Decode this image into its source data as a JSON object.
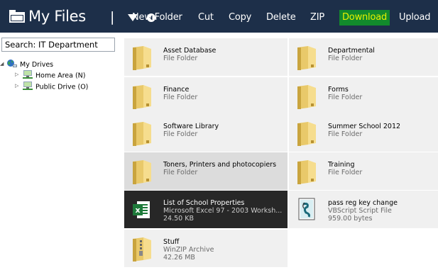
{
  "header": {
    "title": "My Files",
    "separator": "|",
    "toolbar": [
      {
        "id": "new-folder",
        "label": "New Folder"
      },
      {
        "id": "cut",
        "label": "Cut"
      },
      {
        "id": "copy",
        "label": "Copy"
      },
      {
        "id": "delete",
        "label": "Delete"
      },
      {
        "id": "zip",
        "label": "ZIP"
      },
      {
        "id": "download",
        "label": "Download",
        "active": true
      },
      {
        "id": "upload",
        "label": "Upload"
      }
    ],
    "active_color": "#128a2c",
    "active_text_color": "#e6f000",
    "bar_color": "#1d2f49"
  },
  "sidebar": {
    "search_value": "Search: IT Department",
    "root": {
      "label": "My Drives",
      "icon": "network-globe-icon"
    },
    "drives": [
      {
        "label": "Home Area (N)",
        "icon": "network-drive-icon"
      },
      {
        "label": "Public Drive (O)",
        "icon": "network-drive-icon"
      }
    ]
  },
  "files": [
    {
      "name": "Asset Database",
      "type": "File Folder",
      "size": "",
      "icon": "folder-icon"
    },
    {
      "name": "Departmental",
      "type": "File Folder",
      "size": "",
      "icon": "folder-icon"
    },
    {
      "name": "Finance",
      "type": "File Folder",
      "size": "",
      "icon": "folder-icon"
    },
    {
      "name": "Forms",
      "type": "File Folder",
      "size": "",
      "icon": "folder-icon"
    },
    {
      "name": "Software Library",
      "type": "File Folder",
      "size": "",
      "icon": "folder-icon"
    },
    {
      "name": "Summer School 2012",
      "type": "File Folder",
      "size": "",
      "icon": "folder-icon"
    },
    {
      "name": "Toners, Printers and photocopiers",
      "type": "File Folder",
      "size": "",
      "icon": "folder-icon",
      "state": "hover"
    },
    {
      "name": "Training",
      "type": "File Folder",
      "size": "",
      "icon": "folder-icon"
    },
    {
      "name": "List of School Properties",
      "type": "Microsoft Excel 97 - 2003 Worksh...",
      "size": "24.50 KB",
      "icon": "excel-file-icon",
      "state": "selected"
    },
    {
      "name": "pass reg key change",
      "type": "VBScript Script File",
      "size": "959.00 bytes",
      "icon": "vbscript-file-icon"
    },
    {
      "name": "Stuff",
      "type": "WinZIP Archive",
      "size": "42.26 MB",
      "icon": "zip-folder-icon"
    }
  ]
}
